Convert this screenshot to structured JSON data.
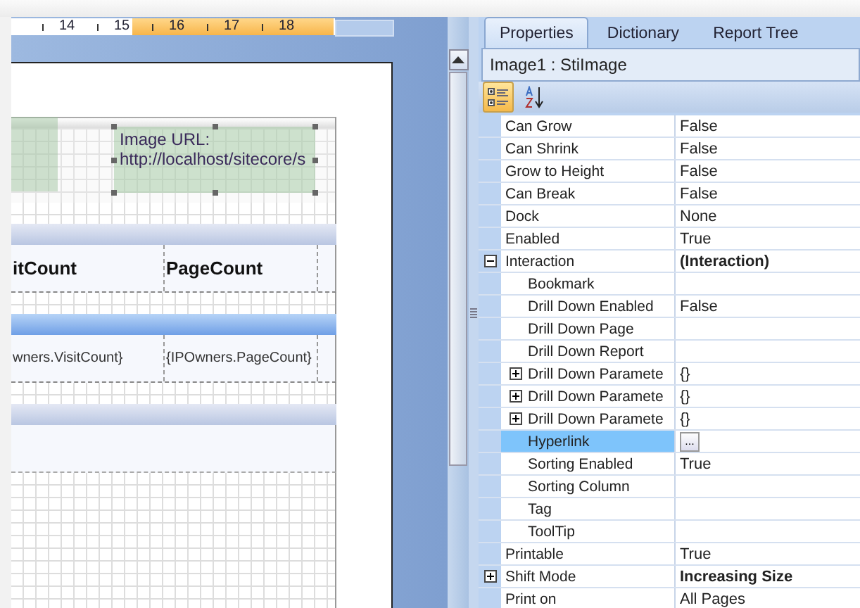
{
  "designer": {
    "ruler": [
      "14",
      "15",
      "16",
      "17",
      "18"
    ],
    "image": {
      "label": "Image URL:",
      "url": "http://localhost/sitecore/s",
      "selected": true
    },
    "header_cells": [
      "itCount",
      "PageCount"
    ],
    "data_cells": [
      "wners.VisitCount}",
      "{IPOwners.PageCount}"
    ]
  },
  "properties_panel": {
    "tabs": [
      {
        "label": "Properties",
        "selected": true
      },
      {
        "label": "Dictionary",
        "selected": false
      },
      {
        "label": "Report Tree",
        "selected": false
      }
    ],
    "object_title": "Image1 : StiImage",
    "toolbar": [
      {
        "kind": "categorized",
        "selected": true
      },
      {
        "kind": "alphabetical",
        "selected": false
      }
    ],
    "properties": [
      {
        "name": "Can Grow",
        "value": "False",
        "selected": false
      },
      {
        "name": "Can Shrink",
        "value": "False",
        "selected": false
      },
      {
        "name": "Grow to Height",
        "value": "False",
        "selected": false
      },
      {
        "name": "Can Break",
        "value": "False",
        "selected": false
      },
      {
        "name": "Dock",
        "value": "None",
        "selected": false
      },
      {
        "name": "Enabled",
        "value": "True",
        "selected": false
      },
      {
        "name": "Interaction",
        "value": "(Interaction)",
        "bold": true,
        "expanded": true,
        "selected": false,
        "children": [
          {
            "name": "Bookmark",
            "selected": false
          },
          {
            "name": "Drill Down Enabled",
            "value": "False",
            "selected": false
          },
          {
            "name": "Drill Down Page",
            "selected": false
          },
          {
            "name": "Drill Down Report",
            "selected": false
          },
          {
            "name": "Drill Down Paramete",
            "value": "{}",
            "expanded": false,
            "selected": false
          },
          {
            "name": "Drill Down Paramete",
            "value": "{}",
            "expanded": false,
            "selected": false
          },
          {
            "name": "Drill Down Paramete",
            "value": "{}",
            "expanded": false,
            "selected": false
          },
          {
            "name": "Hyperlink",
            "button": "...",
            "selected": true
          },
          {
            "name": "Sorting Enabled",
            "value": "True",
            "selected": false
          },
          {
            "name": "Sorting Column",
            "selected": false
          },
          {
            "name": "Tag",
            "selected": false
          },
          {
            "name": "ToolTip",
            "selected": false
          }
        ]
      },
      {
        "name": "Printable",
        "value": "True",
        "selected": false
      },
      {
        "name": "Shift Mode",
        "value": "Increasing Size",
        "bold": true,
        "expanded": false,
        "selected": false
      },
      {
        "name": "Print on",
        "value": "All Pages",
        "selected": false
      }
    ]
  }
}
